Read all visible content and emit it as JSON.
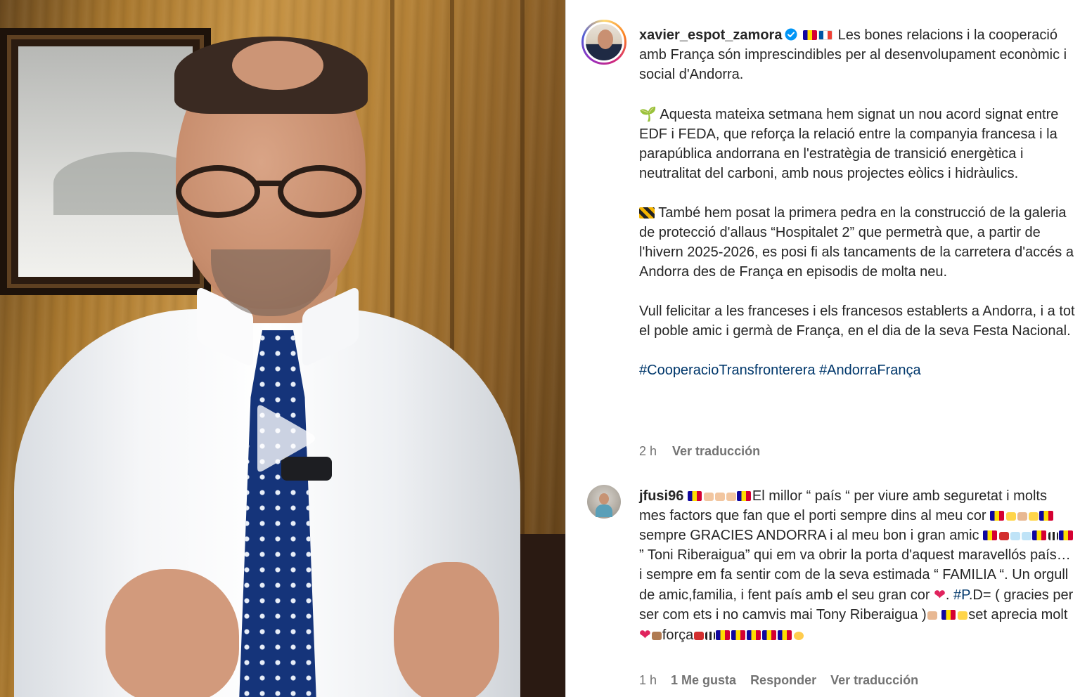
{
  "post": {
    "username": "xavier_espot_zamora",
    "verified": true,
    "caption_intro": "Les bones relacions i la cooperació amb França són imprescindibles per al desenvolupament econòmic i social d'Andorra.",
    "paragraph_1": "Aquesta mateixa setmana hem signat un nou acord signat entre EDF i FEDA, que reforça la relació entre la companyia francesa i la parapública andorrana en l'estratègia de transició energètica i neutralitat del carboni, amb nous projectes eòlics i hidràulics.",
    "paragraph_2": "També hem posat la primera pedra en la construcció de la galeria de protecció d'allaus “Hospitalet 2” que permetrà que, a partir de l'hivern 2025-2026, es posi fi als tancaments de la carretera d'accés a Andorra des de França en episodis de molta neu.",
    "paragraph_3": "Vull felicitar a les franceses i els francesos establerts a Andorra, i a tot el poble amic i germà de França, en el dia de la seva Festa Nacional.",
    "hashtag_1": "#CooperacioTransfronterera",
    "hashtag_2": "#AndorraFrança",
    "time": "2 h",
    "translate_label": "Ver traducción",
    "icons": {
      "verified": "verified-badge-icon",
      "sprout": "seedling-icon",
      "construction": "construction-barrier-icon"
    }
  },
  "video": {
    "play_icon": "play-icon"
  },
  "comment": {
    "username": "jfusi96",
    "text_1": "El millor “ país “ per viure amb seguretat i molts mes factors que fan que el porti sempre dins al meu cor",
    "text_2": "sempre GRACIES ANDORRA i al meu bon i gran amic",
    "text_3": "” Toni Riberaigua” qui em va obrir la porta d'aquest maravellós país… i sempre em fa sentir com de la seva estimada “ FAMILIA “. Un orgull de amic,familia, i fent país amb el seu gran cor",
    "tag": "#P",
    "text_4": ".D= ( gracies per ser com ets i no camvis mai Tony Riberaigua )",
    "text_5": "set aprecia molt",
    "text_6": "força",
    "time": "1 h",
    "likes_label": "1 Me gusta",
    "reply_label": "Responder",
    "translate_label": "Ver traducción"
  },
  "colors": {
    "link": "#00376b",
    "muted": "#737373",
    "text": "#262626",
    "verified": "#0095f6"
  }
}
